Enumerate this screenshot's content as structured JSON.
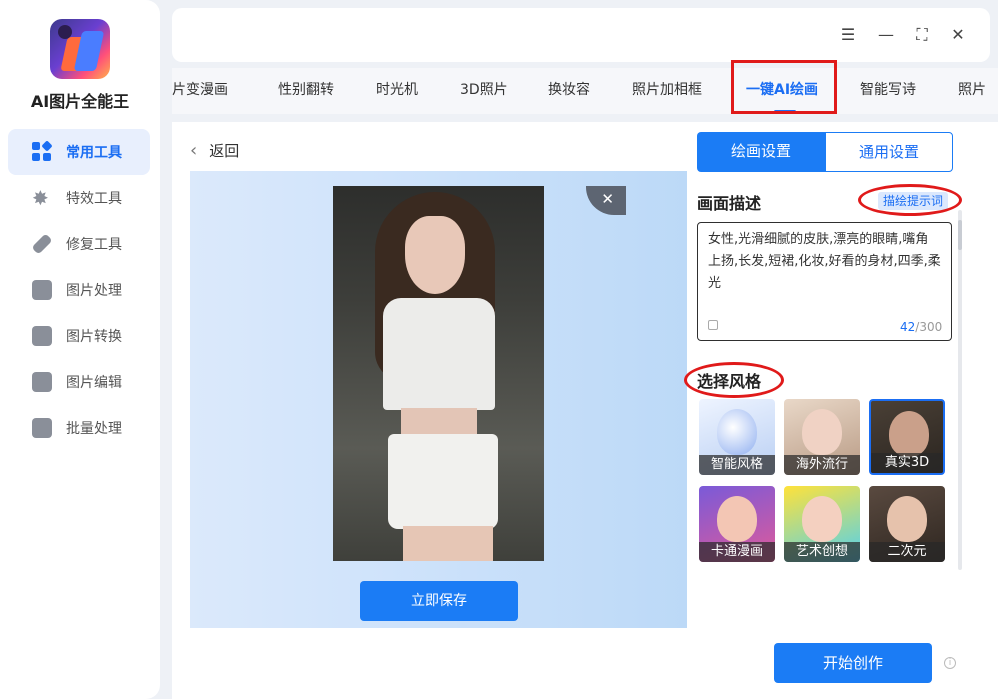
{
  "app": {
    "title": "AI图片全能王"
  },
  "sidebar": {
    "items": [
      {
        "label": "常用工具",
        "icon": "grid-icon",
        "active": true
      },
      {
        "label": "特效工具",
        "icon": "sparkle-icon"
      },
      {
        "label": "修复工具",
        "icon": "bandage-icon"
      },
      {
        "label": "图片处理",
        "icon": "image-icon"
      },
      {
        "label": "图片转换",
        "icon": "convert-icon"
      },
      {
        "label": "图片编辑",
        "icon": "edit-icon"
      },
      {
        "label": "批量处理",
        "icon": "upload-icon"
      }
    ]
  },
  "window": {
    "menu": "☰",
    "minimize": "—",
    "maximize": "⛶",
    "close": "✕"
  },
  "tabs": [
    {
      "label": "照片变漫画"
    },
    {
      "label": "性别翻转"
    },
    {
      "label": "时光机"
    },
    {
      "label": "3D照片"
    },
    {
      "label": "换妆容"
    },
    {
      "label": "照片加相框"
    },
    {
      "label": "一键AI绘画",
      "active": true
    },
    {
      "label": "智能写诗"
    },
    {
      "label": "照片"
    }
  ],
  "main": {
    "back_label": "返回",
    "close_glyph": "✕",
    "save_label": "立即保存"
  },
  "settings": {
    "tab_drawing": "绘画设置",
    "tab_general": "通用设置",
    "desc_title": "画面描述",
    "hint_button": "描绘提示词",
    "prompt_text": "女性,光滑细腻的皮肤,漂亮的眼睛,嘴角上扬,长发,短裙,化妆,好看的身材,四季,柔光",
    "count_current": "42",
    "count_max": "/300",
    "style_title": "选择风格",
    "styles": [
      {
        "label": "智能风格"
      },
      {
        "label": "海外流行"
      },
      {
        "label": "真实3D",
        "selected": true
      },
      {
        "label": "卡通漫画"
      },
      {
        "label": "艺术创想"
      },
      {
        "label": "二次元"
      }
    ],
    "start_label": "开始创作",
    "info_glyph": "i"
  },
  "colors": {
    "accent": "#1b7cf5",
    "annotation_red": "#e01a1a"
  }
}
